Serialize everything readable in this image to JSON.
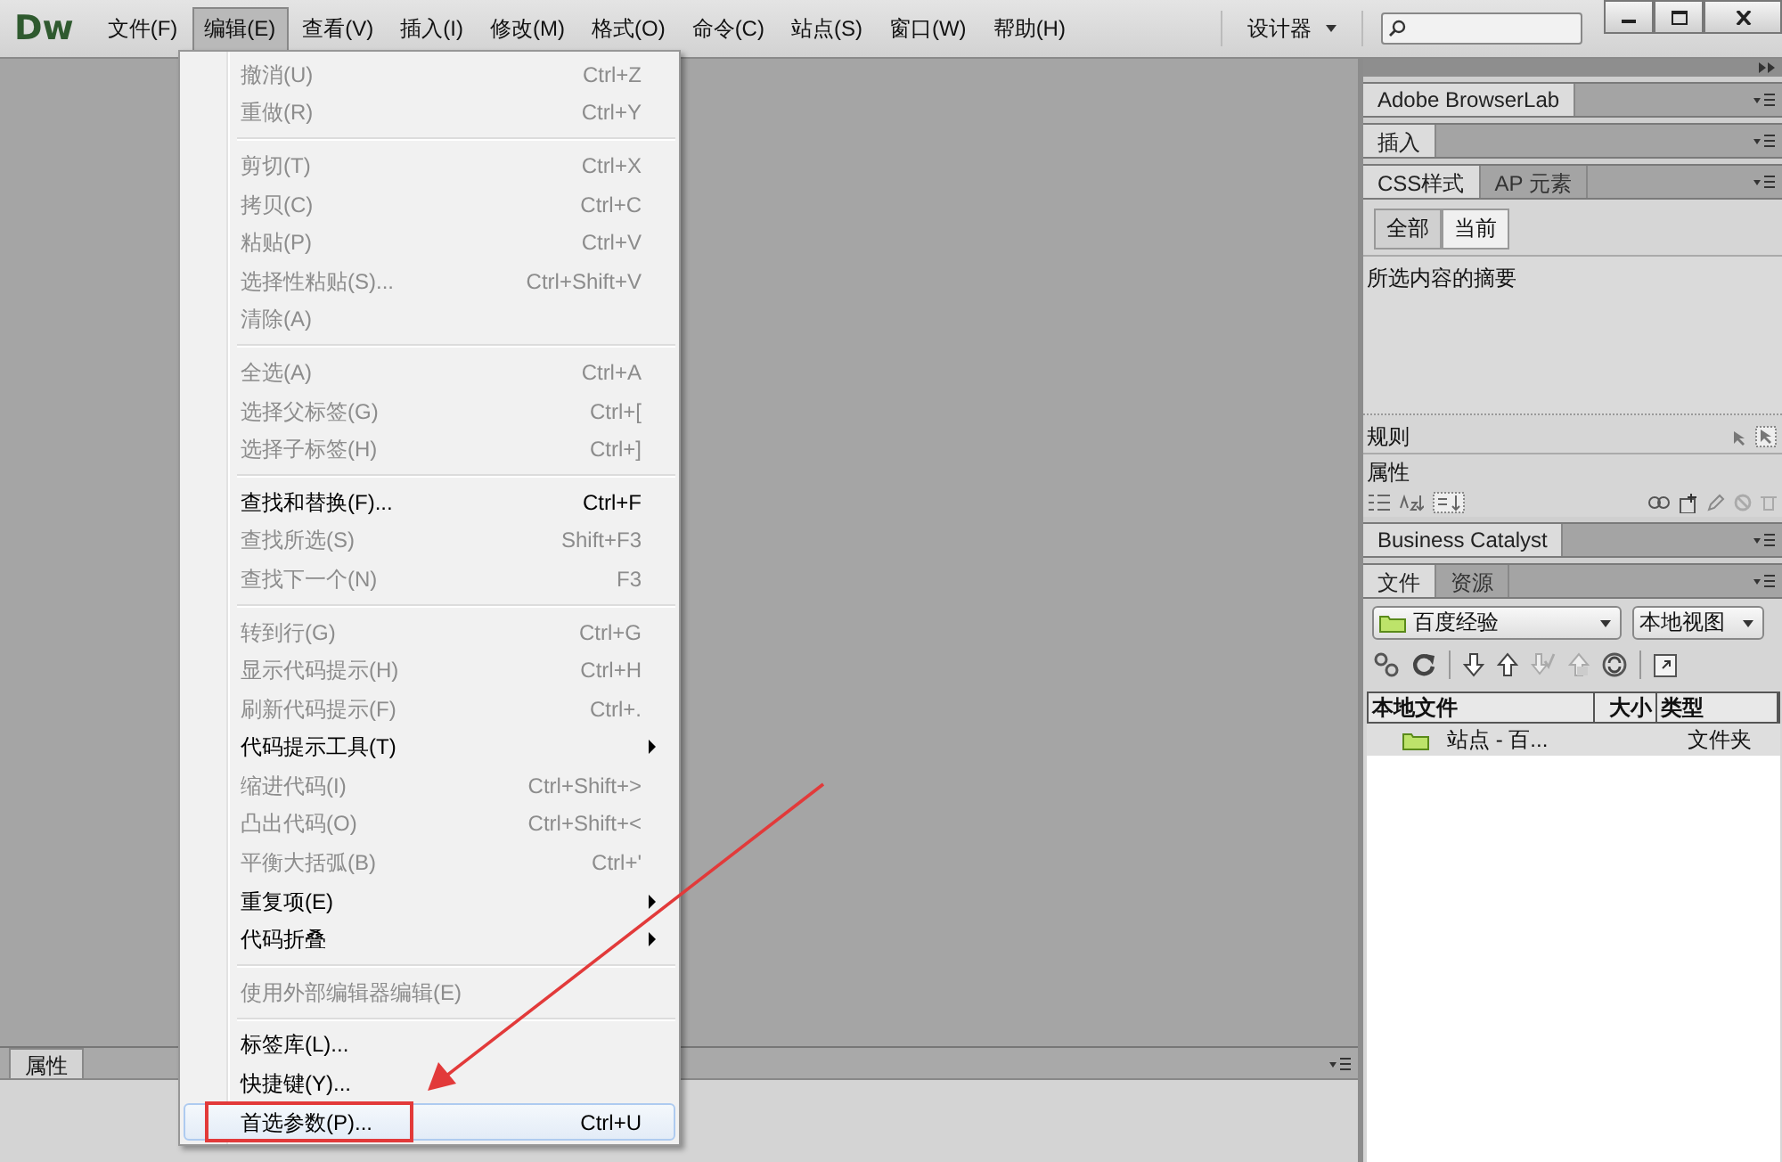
{
  "app": {
    "logo": "Dw"
  },
  "menubar": [
    {
      "label": "文件(F)",
      "selected": false
    },
    {
      "label": "编辑(E)",
      "selected": true
    },
    {
      "label": "查看(V)",
      "selected": false
    },
    {
      "label": "插入(I)",
      "selected": false
    },
    {
      "label": "修改(M)",
      "selected": false
    },
    {
      "label": "格式(O)",
      "selected": false
    },
    {
      "label": "命令(C)",
      "selected": false
    },
    {
      "label": "站点(S)",
      "selected": false
    },
    {
      "label": "窗口(W)",
      "selected": false
    },
    {
      "label": "帮助(H)",
      "selected": false
    }
  ],
  "workspace_switcher": {
    "label": "设计器"
  },
  "edit_menu": {
    "items": [
      {
        "kind": "item",
        "label": "撤消(U)",
        "shortcut": "Ctrl+Z",
        "disabled": true,
        "submenu": false,
        "selected": false
      },
      {
        "kind": "item",
        "label": "重做(R)",
        "shortcut": "Ctrl+Y",
        "disabled": true,
        "submenu": false,
        "selected": false
      },
      {
        "kind": "separator"
      },
      {
        "kind": "item",
        "label": "剪切(T)",
        "shortcut": "Ctrl+X",
        "disabled": true,
        "submenu": false,
        "selected": false
      },
      {
        "kind": "item",
        "label": "拷贝(C)",
        "shortcut": "Ctrl+C",
        "disabled": true,
        "submenu": false,
        "selected": false
      },
      {
        "kind": "item",
        "label": "粘贴(P)",
        "shortcut": "Ctrl+V",
        "disabled": true,
        "submenu": false,
        "selected": false
      },
      {
        "kind": "item",
        "label": "选择性粘贴(S)...",
        "shortcut": "Ctrl+Shift+V",
        "disabled": true,
        "submenu": false,
        "selected": false
      },
      {
        "kind": "item",
        "label": "清除(A)",
        "disabled": true,
        "submenu": false,
        "selected": false
      },
      {
        "kind": "separator"
      },
      {
        "kind": "item",
        "label": "全选(A)",
        "shortcut": "Ctrl+A",
        "disabled": true,
        "submenu": false,
        "selected": false
      },
      {
        "kind": "item",
        "label": "选择父标签(G)",
        "shortcut": "Ctrl+[",
        "disabled": true,
        "submenu": false,
        "selected": false
      },
      {
        "kind": "item",
        "label": "选择子标签(H)",
        "shortcut": "Ctrl+]",
        "disabled": true,
        "submenu": false,
        "selected": false
      },
      {
        "kind": "separator"
      },
      {
        "kind": "item",
        "label": "查找和替换(F)...",
        "shortcut": "Ctrl+F",
        "disabled": false,
        "submenu": false,
        "selected": false
      },
      {
        "kind": "item",
        "label": "查找所选(S)",
        "shortcut": "Shift+F3",
        "disabled": true,
        "submenu": false,
        "selected": false
      },
      {
        "kind": "item",
        "label": "查找下一个(N)",
        "shortcut": "F3",
        "disabled": true,
        "submenu": false,
        "selected": false
      },
      {
        "kind": "separator"
      },
      {
        "kind": "item",
        "label": "转到行(G)",
        "shortcut": "Ctrl+G",
        "disabled": true,
        "submenu": false,
        "selected": false
      },
      {
        "kind": "item",
        "label": "显示代码提示(H)",
        "shortcut": "Ctrl+H",
        "disabled": true,
        "submenu": false,
        "selected": false
      },
      {
        "kind": "item",
        "label": "刷新代码提示(F)",
        "shortcut": "Ctrl+.",
        "disabled": true,
        "submenu": false,
        "selected": false
      },
      {
        "kind": "item",
        "label": "代码提示工具(T)",
        "disabled": false,
        "submenu": true,
        "selected": false
      },
      {
        "kind": "item",
        "label": "缩进代码(I)",
        "shortcut": "Ctrl+Shift+>",
        "disabled": true,
        "submenu": false,
        "selected": false
      },
      {
        "kind": "item",
        "label": "凸出代码(O)",
        "shortcut": "Ctrl+Shift+<",
        "disabled": true,
        "submenu": false,
        "selected": false
      },
      {
        "kind": "item",
        "label": "平衡大括弧(B)",
        "shortcut": "Ctrl+'",
        "disabled": true,
        "submenu": false,
        "selected": false
      },
      {
        "kind": "item",
        "label": "重复项(E)",
        "disabled": false,
        "submenu": true,
        "selected": false
      },
      {
        "kind": "item",
        "label": "代码折叠",
        "disabled": false,
        "submenu": true,
        "selected": false
      },
      {
        "kind": "separator"
      },
      {
        "kind": "item",
        "label": "使用外部编辑器编辑(E)",
        "disabled": true,
        "submenu": false,
        "selected": false
      },
      {
        "kind": "separator"
      },
      {
        "kind": "item",
        "label": "标签库(L)...",
        "disabled": false,
        "submenu": false,
        "selected": false
      },
      {
        "kind": "item",
        "label": "快捷键(Y)...",
        "disabled": false,
        "submenu": false,
        "selected": false
      },
      {
        "kind": "item",
        "label": "首选参数(P)...",
        "shortcut": "Ctrl+U",
        "disabled": false,
        "submenu": false,
        "selected": true
      }
    ]
  },
  "panel_groups": [
    {
      "kind": "tabs",
      "tabs": [
        {
          "label": "Adobe BrowserLab",
          "selected": true
        }
      ]
    },
    {
      "kind": "tabs",
      "tabs": [
        {
          "label": "插入",
          "selected": true
        }
      ]
    },
    {
      "kind": "css",
      "tabs": [
        {
          "label": "CSS样式",
          "selected": true
        },
        {
          "label": "AP 元素",
          "selected": false
        }
      ]
    },
    {
      "kind": "tabs",
      "tabs": [
        {
          "label": "Business Catalyst",
          "selected": true
        }
      ]
    },
    {
      "kind": "files",
      "tabs": [
        {
          "label": "文件",
          "selected": true
        },
        {
          "label": "资源",
          "selected": false
        }
      ]
    }
  ],
  "css_panel": {
    "modes": [
      {
        "label": "全部",
        "selected": false
      },
      {
        "label": "当前",
        "selected": true
      }
    ],
    "summary_title": "所选内容的摘要",
    "rules_label": "规则",
    "properties_label": "属性"
  },
  "files_panel": {
    "site": "百度经验",
    "view": "本地视图",
    "columns": [
      "本地文件",
      "大小",
      "类型"
    ],
    "rows": [
      {
        "name": "站点 - 百...",
        "type": "文件夹"
      }
    ]
  },
  "properties_panel": {
    "tab": "属性"
  }
}
